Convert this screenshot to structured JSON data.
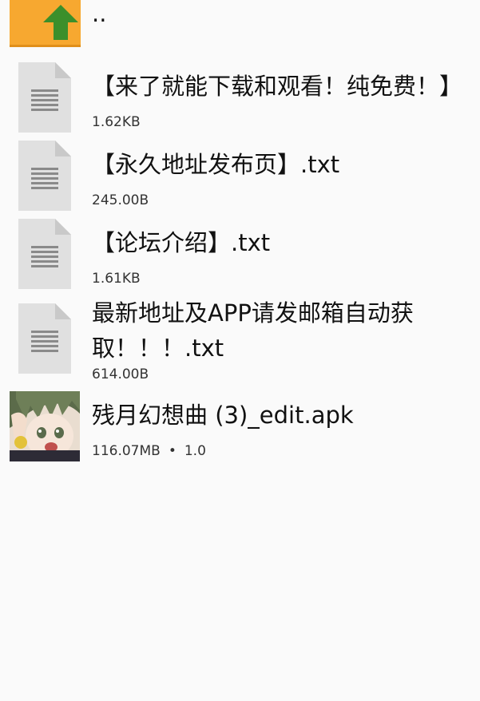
{
  "colors": {
    "background": "#fafafa",
    "folder": "#f7a830",
    "folder_arrow": "#3b8f2b",
    "doc_icon": "#e0e0e0",
    "doc_lines": "#8a8a8a"
  },
  "parent_dir": {
    "icon": "folder-up-icon",
    "label": ".."
  },
  "files": [
    {
      "name": "【来了就能下载和观看！纯免费！】",
      "meta": "1.62KB",
      "icon": "text-file-icon"
    },
    {
      "name": "【永久地址发布页】.txt",
      "meta": "245.00B",
      "icon": "text-file-icon"
    },
    {
      "name": "【论坛介绍】.txt",
      "meta": "1.61KB",
      "icon": "text-file-icon"
    },
    {
      "name": "最新地址及APP请发邮箱自动获取！！！.txt",
      "meta": "614.00B",
      "icon": "text-file-icon"
    },
    {
      "name": "残月幻想曲 (3)_edit.apk",
      "meta_size": "116.07MB",
      "meta_sep": "•",
      "meta_version": "1.0",
      "icon": "app-icon"
    }
  ]
}
